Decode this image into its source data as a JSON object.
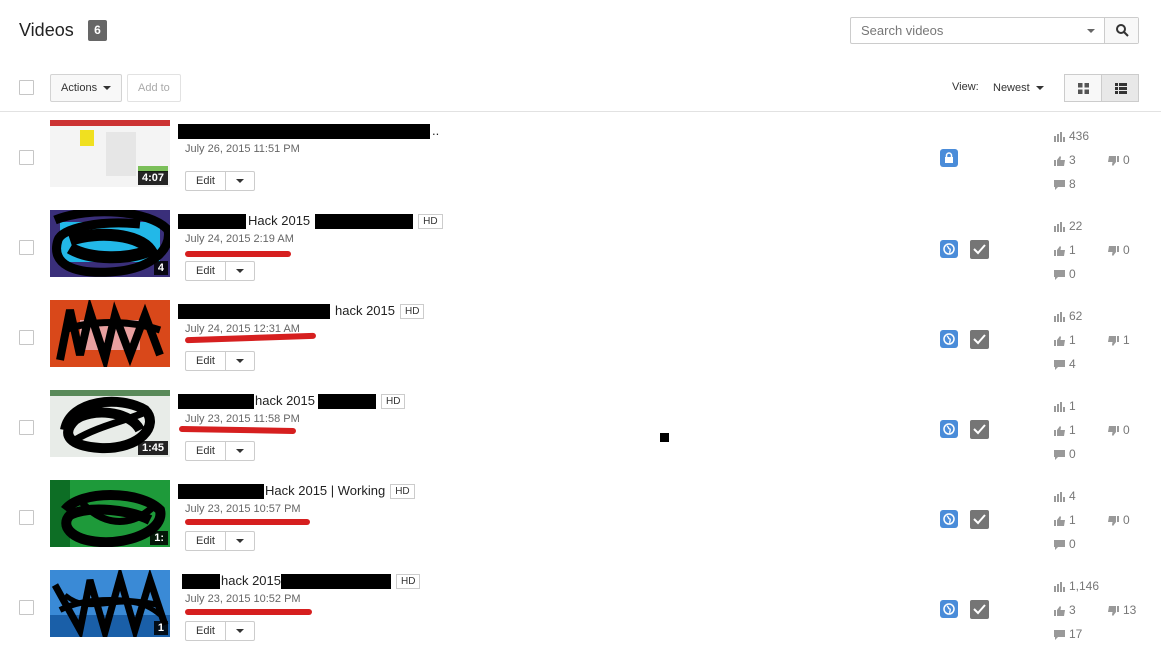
{
  "header": {
    "title": "Videos",
    "count": "6",
    "search_placeholder": "Search videos"
  },
  "toolbar": {
    "actions_label": "Actions",
    "add_to_label": "Add to",
    "view_label": "View:",
    "sort_label": "Newest"
  },
  "videos": [
    {
      "title_visible": "",
      "title_suffix": "..",
      "hd": "",
      "date": "July 26, 2015 11:51 PM",
      "duration": "4:07",
      "edit_label": "Edit",
      "privacy": "private",
      "views": "436",
      "likes": "3",
      "dislikes": "0",
      "comments": "8"
    },
    {
      "title_visible": "Hack 2015",
      "title_suffix": "",
      "hd": "HD",
      "date": "July 24, 2015 2:19 AM",
      "duration": "4",
      "edit_label": "Edit",
      "privacy": "public",
      "views": "22",
      "likes": "1",
      "dislikes": "0",
      "comments": "0"
    },
    {
      "title_visible": "hack 2015",
      "title_suffix": "",
      "hd": "HD",
      "date": "July 24, 2015 12:31 AM",
      "duration": "",
      "edit_label": "Edit",
      "privacy": "public",
      "views": "62",
      "likes": "1",
      "dislikes": "1",
      "comments": "4"
    },
    {
      "title_visible": "hack 2015",
      "title_suffix": "",
      "hd": "HD",
      "date": "July 23, 2015 11:58 PM",
      "duration": "1:45",
      "edit_label": "Edit",
      "privacy": "public",
      "views": "1",
      "likes": "1",
      "dislikes": "0",
      "comments": "0"
    },
    {
      "title_visible": "Hack 2015 | Working",
      "title_suffix": "",
      "hd": "HD",
      "date": "July 23, 2015 10:57 PM",
      "duration": "1:",
      "edit_label": "Edit",
      "privacy": "public",
      "views": "4",
      "likes": "1",
      "dislikes": "0",
      "comments": "0"
    },
    {
      "title_visible": "hack 2015",
      "title_suffix": "",
      "hd": "HD",
      "date": "July 23, 2015 10:52 PM",
      "duration": "1",
      "edit_label": "Edit",
      "privacy": "public",
      "views": "1,146",
      "likes": "3",
      "dislikes": "13",
      "comments": "17"
    }
  ],
  "colors": {
    "privacy_blue": "#4a8cd9",
    "annotation_red": "#d61f1f",
    "redaction_black": "#000000"
  },
  "icons": {
    "search": "search-icon",
    "grid_view": "grid-view-icon",
    "list_view": "list-view-icon",
    "private": "lock-icon",
    "public": "globe-icon",
    "monetized": "check-icon",
    "views": "bar-chart-icon",
    "likes": "thumbs-up-icon",
    "dislikes": "thumbs-down-icon",
    "comments": "comment-icon"
  }
}
